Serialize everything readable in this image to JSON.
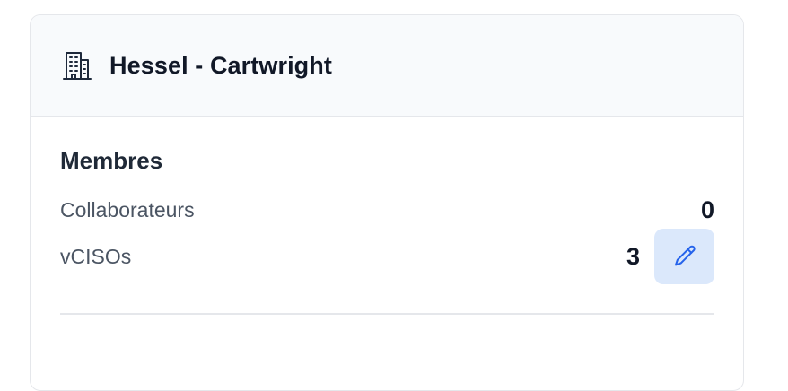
{
  "card": {
    "title": "Hessel - Cartwright",
    "title_icon": "building-icon"
  },
  "members": {
    "heading": "Membres",
    "rows": [
      {
        "label": "Collaborateurs",
        "value": "0"
      },
      {
        "label": "vCISOs",
        "value": "3",
        "action_icon": "pencil-icon"
      }
    ]
  },
  "colors": {
    "header_bg": "#f8fafc",
    "edit_button_bg": "#dbe8fb",
    "icon_stroke": "#1e3a8a",
    "pencil_stroke": "#2563eb"
  }
}
